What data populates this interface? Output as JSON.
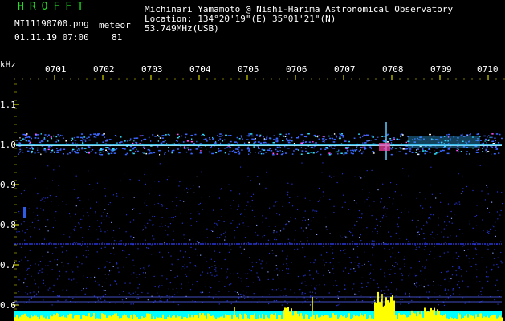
{
  "header": {
    "brand": "HROFFT",
    "file_name": "MI11190700.png",
    "meteor_label": "meteor",
    "datetime": "01.11.19 07:00",
    "meteor_count": "81"
  },
  "observatory": {
    "line1": "Michinari Yamamoto @ Nishi-Harima Astronomical Observatory",
    "line2": "Location: 134°20'19\"(E) 35°01'21\"(N)",
    "line3": "53.749MHz(USB)"
  },
  "axis": {
    "unit": "kHz",
    "time_ticks": [
      "0701",
      "0702",
      "0703",
      "0704",
      "0705",
      "0706",
      "0707",
      "0708",
      "0709",
      "0710"
    ],
    "freq_ticks": [
      "1.1",
      "1.0",
      "0.9",
      "0.8",
      "0.7",
      "0.6"
    ]
  },
  "colors": {
    "brand": "#1fe11f",
    "axis_text": "#ffffff",
    "tick_mark": "#ffff00",
    "spectrum_band": "#3a66ff",
    "signal_base": "#00ffff",
    "signal_peak": "#ffff00",
    "reference_line": "#3340ff"
  }
}
